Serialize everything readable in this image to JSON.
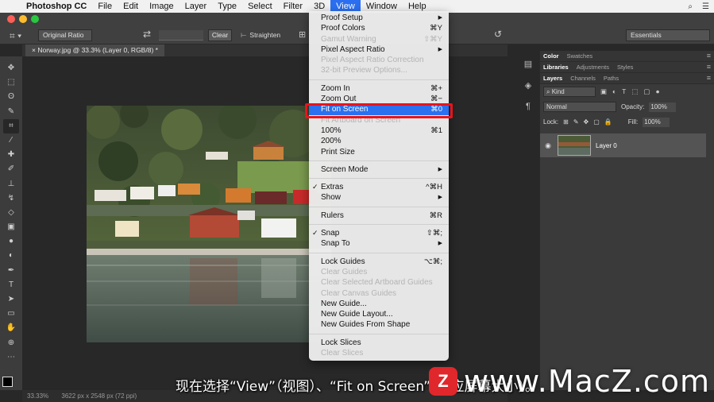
{
  "colors": {
    "menu_highlight": "#2a70ef",
    "callout_red": "#e8141c",
    "watermark_red": "#e0272b"
  },
  "menubar": {
    "apple_icon": "apple-icon",
    "items": [
      "Photoshop CC",
      "File",
      "Edit",
      "Image",
      "Layer",
      "Type",
      "Select",
      "Filter",
      "3D",
      "View",
      "Window",
      "Help"
    ],
    "active": "View"
  },
  "options": {
    "ratio": "Original Ratio",
    "clear": "Clear",
    "straighten": "Straighten",
    "workspace": "Essentials"
  },
  "document": {
    "tab_title": "Norway.jpg @ 33.3% (Layer 0, RGB/8) *"
  },
  "status": {
    "zoom": "33.33%",
    "dimensions": "3622 px x 2548 px (72 ppi)"
  },
  "view_menu": {
    "items": [
      {
        "label": "Proof Setup",
        "shortcut": "",
        "submenu": true,
        "disabled": false
      },
      {
        "label": "Proof Colors",
        "shortcut": "⌘Y",
        "disabled": false
      },
      {
        "label": "Gamut Warning",
        "shortcut": "⇧⌘Y",
        "disabled": true
      },
      {
        "label": "Pixel Aspect Ratio",
        "shortcut": "",
        "submenu": true,
        "disabled": false
      },
      {
        "label": "Pixel Aspect Ratio Correction",
        "shortcut": "",
        "disabled": true
      },
      {
        "label": "32-bit Preview Options...",
        "shortcut": "",
        "disabled": true
      },
      {
        "label": "Zoom In",
        "shortcut": "⌘+",
        "disabled": false
      },
      {
        "label": "Zoom Out",
        "shortcut": "⌘−",
        "disabled": false
      },
      {
        "label": "Fit on Screen",
        "shortcut": "⌘0",
        "disabled": false,
        "highlighted": true
      },
      {
        "label": "Fit Artboard on Screen",
        "shortcut": "",
        "disabled": true
      },
      {
        "label": "100%",
        "shortcut": "⌘1",
        "disabled": false
      },
      {
        "label": "200%",
        "shortcut": "",
        "disabled": false
      },
      {
        "label": "Print Size",
        "shortcut": "",
        "disabled": false
      },
      {
        "label": "Screen Mode",
        "shortcut": "",
        "submenu": true,
        "disabled": false
      },
      {
        "label": "Extras",
        "shortcut": "^⌘H",
        "checked": true,
        "disabled": false
      },
      {
        "label": "Show",
        "shortcut": "",
        "submenu": true,
        "disabled": false
      },
      {
        "label": "Rulers",
        "shortcut": "⌘R",
        "disabled": false
      },
      {
        "label": "Snap",
        "shortcut": "⇧⌘;",
        "checked": true,
        "disabled": false
      },
      {
        "label": "Snap To",
        "shortcut": "",
        "submenu": true,
        "disabled": false
      },
      {
        "label": "Lock Guides",
        "shortcut": "⌥⌘;",
        "disabled": false
      },
      {
        "label": "Clear Guides",
        "shortcut": "",
        "disabled": true
      },
      {
        "label": "Clear Selected Artboard Guides",
        "shortcut": "",
        "disabled": true
      },
      {
        "label": "Clear Canvas Guides",
        "shortcut": "",
        "disabled": true
      },
      {
        "label": "New Guide...",
        "shortcut": "",
        "disabled": false
      },
      {
        "label": "New Guide Layout...",
        "shortcut": "",
        "disabled": false
      },
      {
        "label": "New Guides From Shape",
        "shortcut": "",
        "disabled": false
      },
      {
        "label": "Lock Slices",
        "shortcut": "",
        "disabled": false
      },
      {
        "label": "Clear Slices",
        "shortcut": "",
        "disabled": true
      }
    ]
  },
  "panels": {
    "top_tabs": [
      "Color",
      "Swatches"
    ],
    "mid_tabs": [
      "Libraries",
      "Adjustments",
      "Styles"
    ],
    "layer_tabs": [
      "Layers",
      "Channels",
      "Paths"
    ],
    "kind": "Kind",
    "blend_mode": "Normal",
    "opacity_label": "Opacity:",
    "opacity_value": "100%",
    "lock_label": "Lock:",
    "fill_label": "Fill:",
    "fill_value": "100%",
    "layer_name": "Layer 0"
  },
  "subtitle": "现在选择“View”（视图）、“Fit on Screen”（适应屏幕大小）。",
  "watermark": {
    "logo_letter": "Z",
    "text": "www.MacZ.com"
  }
}
